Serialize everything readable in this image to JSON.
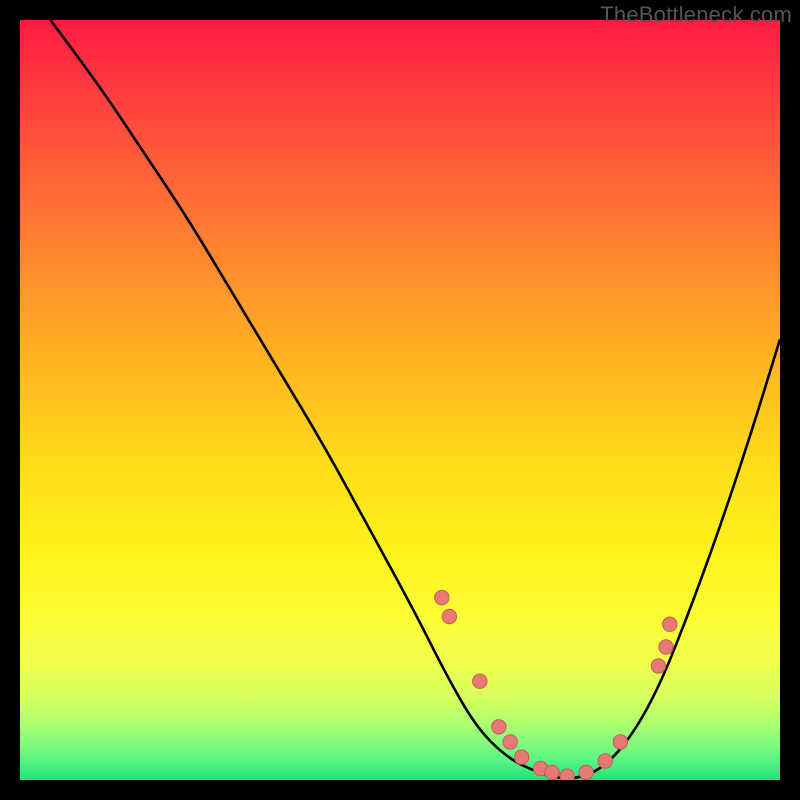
{
  "watermark": "TheBottleneck.com",
  "colors": {
    "background": "#000000",
    "curve": "#000000",
    "dot_fill": "#e77a74",
    "dot_stroke": "#c95a56"
  },
  "chart_data": {
    "type": "line",
    "title": "",
    "xlabel": "",
    "ylabel": "",
    "xlim": [
      0,
      100
    ],
    "ylim": [
      0,
      100
    ],
    "note": "Axes are unlabeled in the source image; values are estimated on a 0–100 scale by pixel position (y is inverted relative to bottleneck %).",
    "series": [
      {
        "name": "bottleneck-curve",
        "x": [
          4,
          10,
          16,
          22,
          28,
          34,
          40,
          46,
          52,
          56,
          60,
          64,
          68,
          72,
          76,
          80,
          84,
          88,
          92,
          96,
          100
        ],
        "y": [
          100,
          92,
          83,
          74,
          64,
          54,
          44,
          33,
          22,
          14,
          7,
          3,
          1,
          0,
          1,
          5,
          12,
          22,
          33,
          45,
          58
        ]
      }
    ],
    "annotations": {
      "dots": [
        {
          "x": 55.5,
          "y": 24.0
        },
        {
          "x": 56.5,
          "y": 21.5
        },
        {
          "x": 60.5,
          "y": 13.0
        },
        {
          "x": 63.0,
          "y": 7.0
        },
        {
          "x": 64.5,
          "y": 5.0
        },
        {
          "x": 66.0,
          "y": 3.0
        },
        {
          "x": 68.5,
          "y": 1.5
        },
        {
          "x": 70.0,
          "y": 1.0
        },
        {
          "x": 72.0,
          "y": 0.5
        },
        {
          "x": 74.5,
          "y": 1.0
        },
        {
          "x": 77.0,
          "y": 2.5
        },
        {
          "x": 79.0,
          "y": 5.0
        },
        {
          "x": 84.0,
          "y": 15.0
        },
        {
          "x": 85.0,
          "y": 17.5
        },
        {
          "x": 85.5,
          "y": 20.5
        }
      ]
    }
  }
}
